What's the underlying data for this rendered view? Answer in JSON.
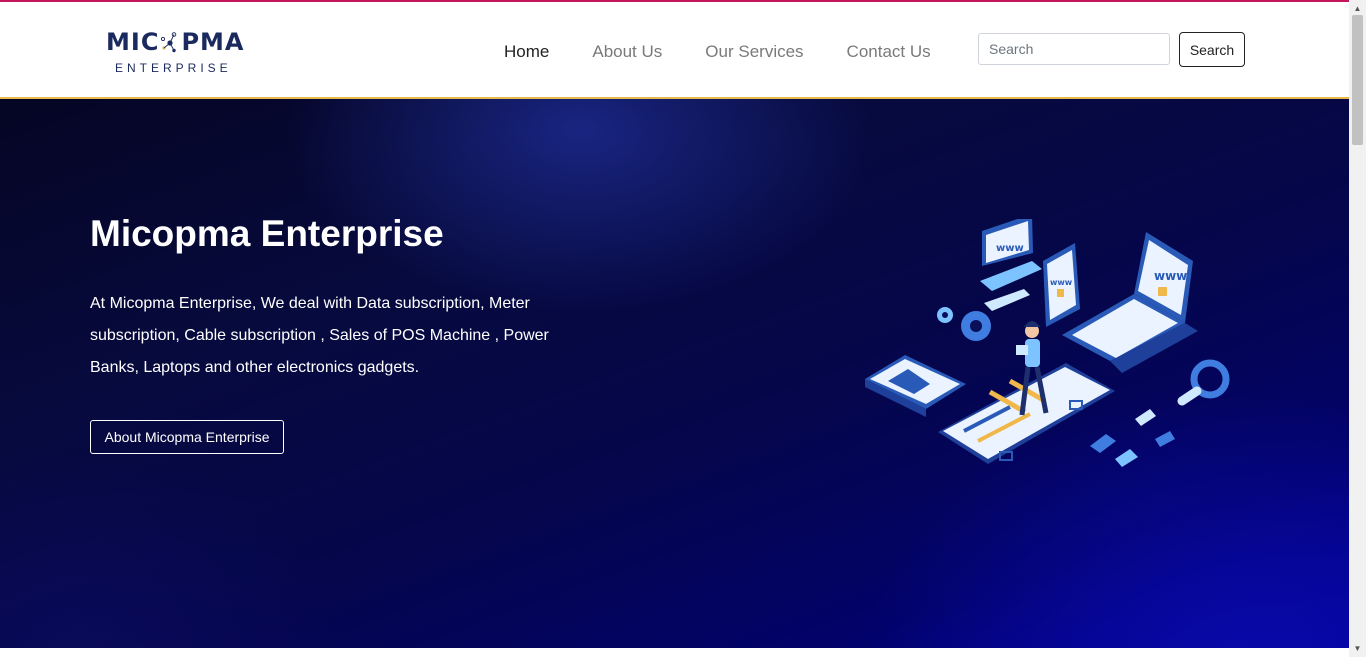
{
  "brand": {
    "logo_text_left": "MIC",
    "logo_text_right": "PMA",
    "logo_subtitle": "ENTERPRISE"
  },
  "nav": {
    "items": [
      {
        "label": "Home",
        "active": true
      },
      {
        "label": "About Us",
        "active": false
      },
      {
        "label": "Our Services",
        "active": false
      },
      {
        "label": "Contact Us",
        "active": false
      }
    ]
  },
  "search": {
    "placeholder": "Search",
    "value": "",
    "button_label": "Search"
  },
  "hero": {
    "title": "Micopma Enterprise",
    "description": "At Micopma Enterprise, We deal with Data subscription, Meter subscription, Cable subscription , Sales of POS Machine , Power Banks, Laptops and other electronics gadgets.",
    "button_label": "About Micopma Enterprise",
    "illustration_icon": "isometric-web-devices-icon",
    "screen_label": "www"
  },
  "colors": {
    "brand_navy": "#1b2a5e",
    "top_stripe": "#c2185b",
    "header_border": "#e5b94a",
    "hero_dark": "#050524",
    "hero_blue": "#0000a0"
  }
}
